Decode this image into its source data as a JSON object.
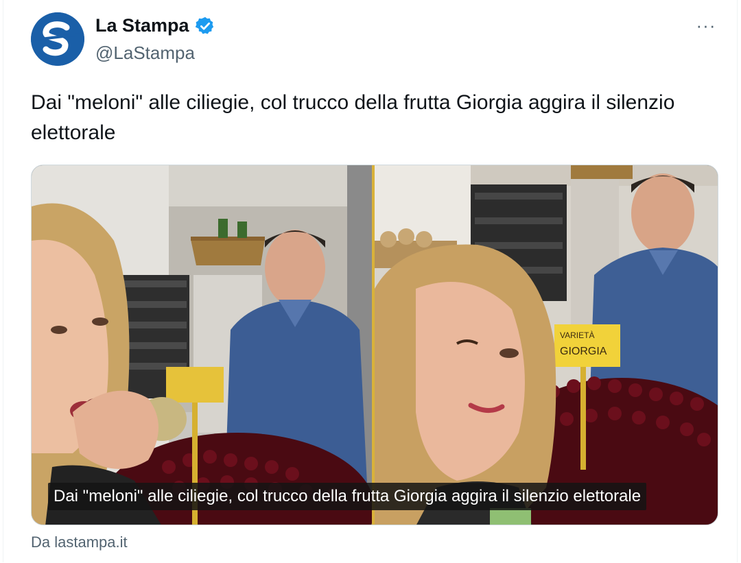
{
  "tweet": {
    "author_name": "La Stampa",
    "handle": "@LaStampa",
    "verified": true,
    "avatar_letter": "S",
    "text": "Dai \"meloni\" alle ciliegie, col trucco della frutta Giorgia aggira il silenzio elettorale",
    "more_label": "···"
  },
  "media": {
    "caption": "Dai \"meloni\" alle ciliegie, col trucco della frutta Giorgia aggira il silenzio elettorale",
    "sign_text_line1": "VARIETÀ",
    "sign_text_line2": "GIORGIA"
  },
  "card": {
    "source_label": "Da lastampa.it"
  },
  "colors": {
    "accent_blue": "#1d9bf0",
    "avatar_blue": "#1a5fa8",
    "secondary_text": "#536471",
    "divider_gold": "#d9b23a"
  }
}
